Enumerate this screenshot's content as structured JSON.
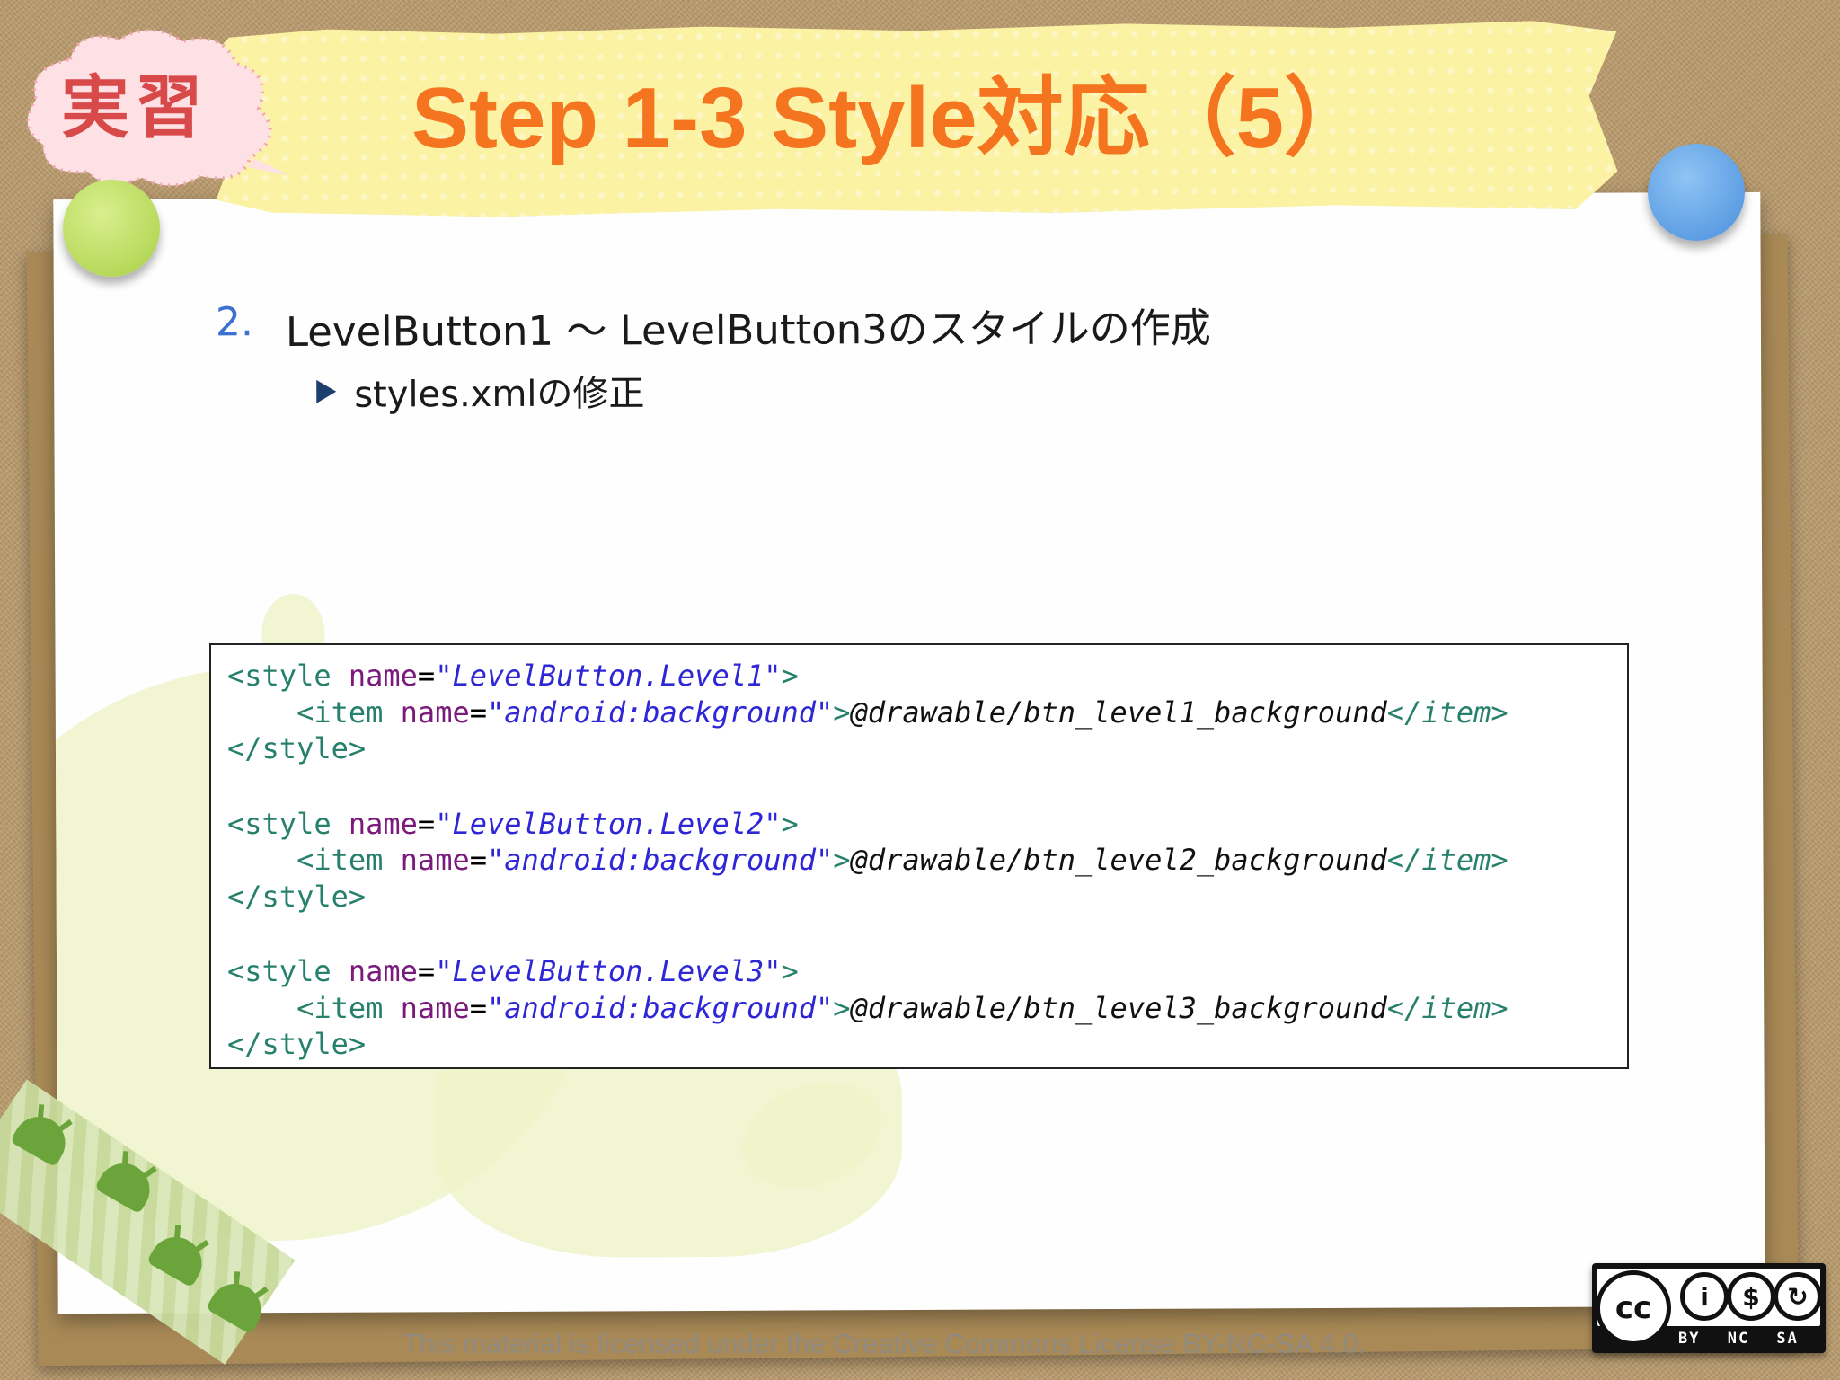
{
  "header": {
    "badge_label": "実習",
    "title": "Step 1-3 Style対応（5）"
  },
  "content": {
    "item_number": "2.",
    "item_text": "LevelButton1 〜 LevelButton3のスタイルの作成",
    "sub_item_text": "styles.xmlの修正"
  },
  "code": {
    "blocks": [
      {
        "open_tag": "<style ",
        "open_attr": "name",
        "open_eq": "=",
        "open_val": "\"LevelButton.Level1\"",
        "open_close": ">",
        "item_indent": "    ",
        "item_tag": "<item ",
        "item_attr": "name",
        "item_eq": "=",
        "item_val": "\"android:background\"",
        "item_gt": ">",
        "item_text": "@drawable/btn_level1_background",
        "item_end": "</item>",
        "close_tag": "</style>"
      },
      {
        "open_tag": "<style ",
        "open_attr": "name",
        "open_eq": "=",
        "open_val": "\"LevelButton.Level2\"",
        "open_close": ">",
        "item_indent": "    ",
        "item_tag": "<item ",
        "item_attr": "name",
        "item_eq": "=",
        "item_val": "\"android:background\"",
        "item_gt": ">",
        "item_text": "@drawable/btn_level2_background",
        "item_end": "</item>",
        "close_tag": "</style>"
      },
      {
        "open_tag": "<style ",
        "open_attr": "name",
        "open_eq": "=",
        "open_val": "\"LevelButton.Level3\"",
        "open_close": ">",
        "item_indent": "    ",
        "item_tag": "<item ",
        "item_attr": "name",
        "item_eq": "=",
        "item_val": "\"android:background\"",
        "item_gt": ">",
        "item_text": "@drawable/btn_level3_background",
        "item_end": "</item>",
        "close_tag": "</style>"
      }
    ]
  },
  "footer": {
    "license_text": "This material is licensed under the Creative Commons License BY-NC-SA 4.0.",
    "cc_labels": "BY NC SA"
  },
  "colors": {
    "title": "#f4741f",
    "number": "#3b6fd0",
    "code_tag": "#27806c",
    "code_attr": "#7a1a7a",
    "code_value": "#2f27d6"
  }
}
